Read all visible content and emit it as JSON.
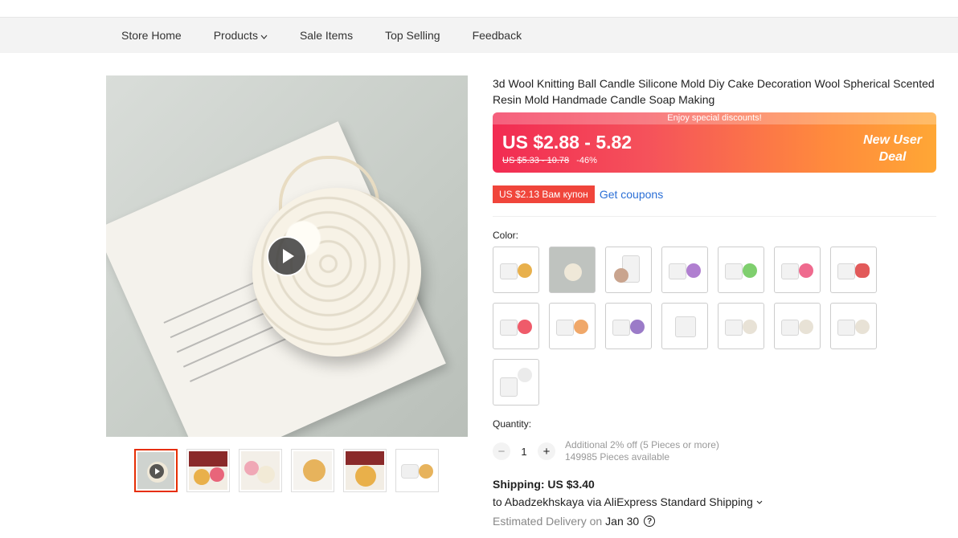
{
  "store_nav": {
    "items": [
      "Store Home",
      "Products",
      "Sale Items",
      "Top Selling",
      "Feedback"
    ],
    "products_chevron": "chevron-down-icon"
  },
  "gallery": {
    "play_icon": "play-icon",
    "thumbnails_count_label": ""
  },
  "product": {
    "title": "3d Wool Knitting Ball Candle Silicone Mold Diy Cake Decoration Wool Spherical Scented Resin Mold Handmade Candle Soap Making",
    "banner_text": "Enjoy special discounts!",
    "price": "US $2.88 - 5.82",
    "original_price": "US $5.33 - 10.78",
    "discount": "-46%",
    "deal_line1": "New User",
    "deal_line2": "Deal",
    "coupon_tag": "US $2.13 Вам купон",
    "get_coupons": "Get coupons"
  },
  "color": {
    "label": "Color:"
  },
  "quantity": {
    "label": "Quantity:",
    "minus": "−",
    "value": "1",
    "plus": "+",
    "additional": "Additional 2% off (5 Pieces or more)",
    "available": "149985 Pieces available"
  },
  "shipping": {
    "title": "Shipping: US $3.40",
    "to": "to Abadzekhskaya via AliExpress Standard Shipping",
    "est_label": "Estimated Delivery on",
    "est_date": "Jan 30",
    "help_icon": "?"
  },
  "colors": {
    "accent": "#e62e04",
    "link": "#2b6fd6"
  }
}
